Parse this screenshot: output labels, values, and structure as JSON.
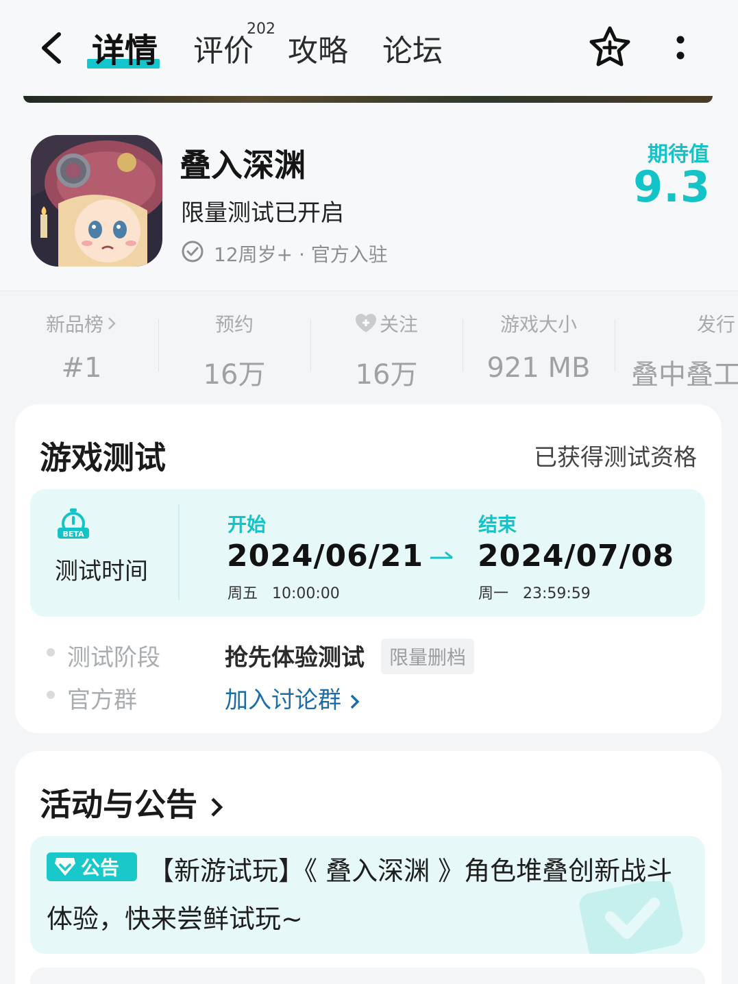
{
  "nav": {
    "tabs": [
      {
        "label": "详情"
      },
      {
        "label": "评价",
        "count": "202"
      },
      {
        "label": "攻略"
      },
      {
        "label": "论坛"
      }
    ]
  },
  "app": {
    "name": "叠入深渊",
    "subtitle": "限量测试已开启",
    "meta": "12周岁+ · 官方入驻",
    "expect_label": "期待值",
    "expect_value": "9.3"
  },
  "stats": [
    {
      "label": "新品榜",
      "value": "#1"
    },
    {
      "label": "预约",
      "value": "16万"
    },
    {
      "label": "关注",
      "value": "16万"
    },
    {
      "label": "游戏大小",
      "value": "921 MB"
    },
    {
      "label": "发行",
      "value": "叠中叠工"
    }
  ],
  "test": {
    "title": "游戏测试",
    "qualified": "已获得测试资格",
    "time_label": "测试时间",
    "start_label": "开始",
    "start_date": "2024/06/21",
    "start_time": "周五   10:00:00",
    "end_label": "结束",
    "end_date": "2024/07/08",
    "end_time": "周一   23:59:59",
    "stage_key": "测试阶段",
    "stage_value": "抢先体验测试",
    "stage_tag": "限量删档",
    "group_key": "官方群",
    "group_link": "加入讨论群"
  },
  "activity": {
    "title": "活动与公告",
    "badge": "公告",
    "notice": "【新游试玩】《 叠入深渊 》角色堆叠创新战斗体验，快来尝鲜试玩~"
  },
  "colors": {
    "accent": "#14c3c8",
    "link": "#1a6ea8",
    "tint": "#e7f8f8"
  }
}
